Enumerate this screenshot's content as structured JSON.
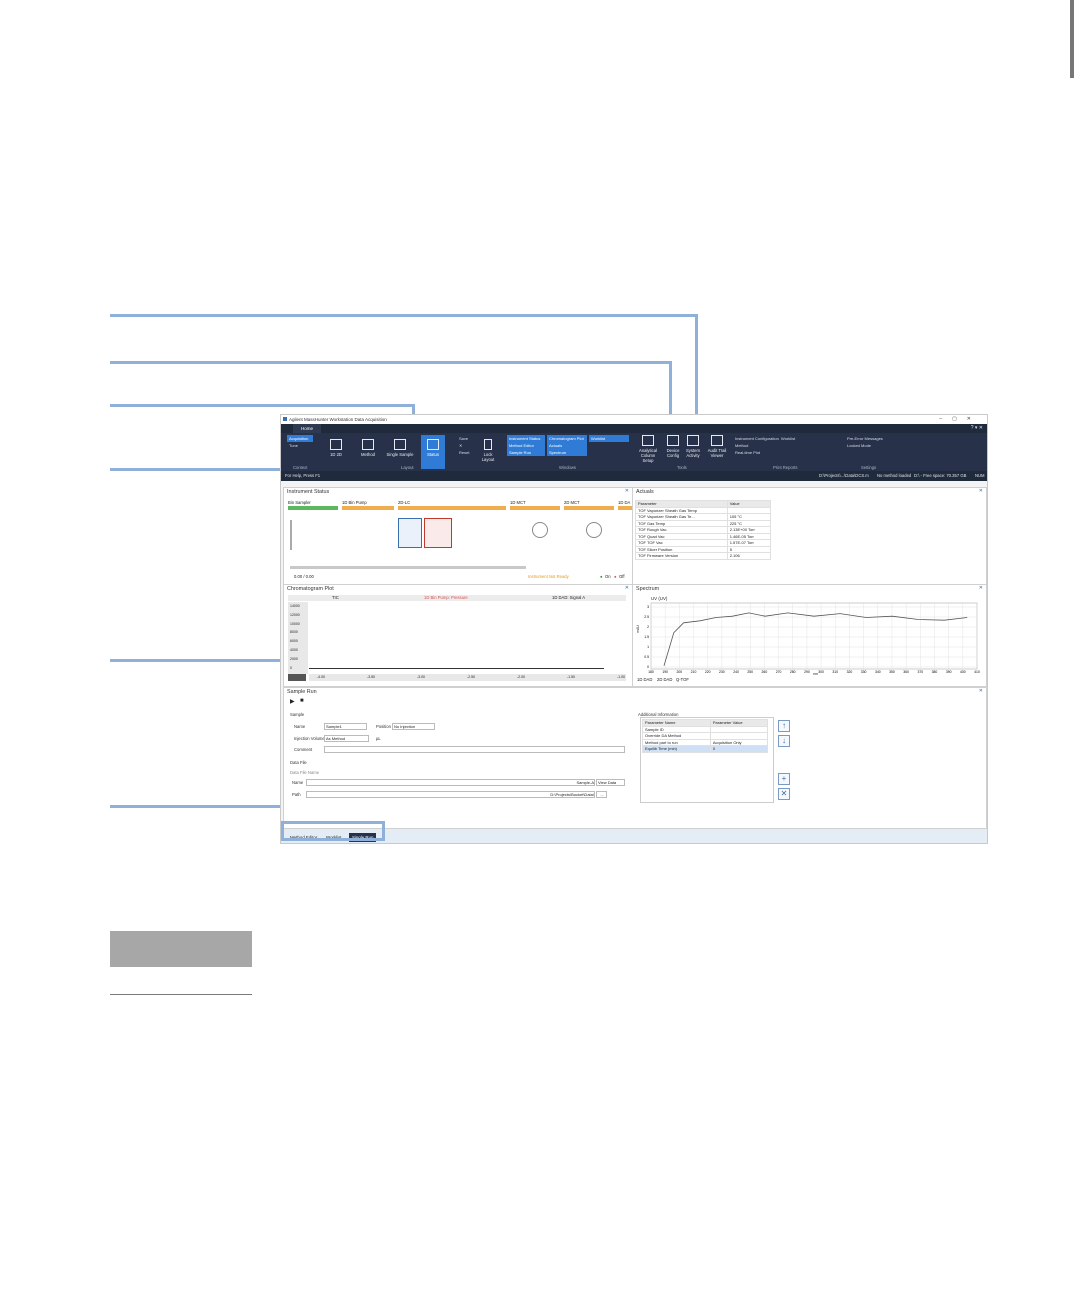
{
  "window": {
    "title": "Agilent MassHunter Workstation Data Acquisition",
    "tab_home": "Home"
  },
  "ribbon": {
    "context_items": [
      "Acquisition",
      "Tune"
    ],
    "context_group": "Context",
    "layout_buttons": [
      "1D 2D",
      "Method",
      "Single Sample",
      "Status"
    ],
    "layout_small": [
      "Save",
      "Reset",
      "Lock Layout"
    ],
    "layout_group": "Layout",
    "windows_col1": [
      "Instrument Status",
      "Method Editor",
      "Sample Run"
    ],
    "windows_col2": [
      "Chromatogram Plot",
      "Actuals",
      "Spectrum"
    ],
    "windows_col3": [
      "Worklist"
    ],
    "windows_group": "Windows",
    "tools_buttons": [
      "Analytical Column Setup",
      "Device Config",
      "System Activity",
      "Audit Trail Viewer"
    ],
    "tools_group": "Tools",
    "print_items": [
      "Instrument Configuration",
      "Method",
      "Real-time Plot"
    ],
    "print_extra": "Worklist",
    "print_group": "Print Reports",
    "settings_items": [
      "Pre-Error Messages",
      "Locked Mode"
    ],
    "settings_group": "Settings"
  },
  "status_bar": {
    "help": "For Help, Press F1",
    "segments": [
      "D:\\Projects\\...\\Data\\DCS.m",
      "No method loaded",
      "D:\\ - Free space: 70.357 GB",
      "NUM"
    ]
  },
  "instrument_status": {
    "title": "Instrument Status",
    "modules": [
      {
        "name": "Bin Sampler",
        "color": "#5cb85c"
      },
      {
        "name": "1D Bin Pump",
        "color": "#f0ad4e"
      },
      {
        "name": "2D-LC",
        "color": "#f0ad4e"
      },
      {
        "name": "1D MCT",
        "color": "#f0ad4e"
      },
      {
        "name": "2D MCT",
        "color": "#f0ad4e"
      },
      {
        "name": "1D DA",
        "color": "#f0ad4e"
      }
    ],
    "readout": "0.00 / 0.00",
    "legend": "Instrument Not Ready",
    "legend_on": "On",
    "legend_off": "Off"
  },
  "actuals": {
    "title": "Actuals",
    "headers": [
      "Parameter",
      "Value"
    ],
    "rows": [
      {
        "param": "TOF  Vaporizer Sheath Gas Temp",
        "value": ""
      },
      {
        "param": "TOF  Vaporizer Sheath Gas Te...",
        "value": "105 °C"
      },
      {
        "param": "TOF  Gas Temp",
        "value": "225 °C"
      },
      {
        "param": "TOF  Rough Vac",
        "value": "2.13E+00 Torr"
      },
      {
        "param": "TOF  Quad Vac",
        "value": "1.46E-05 Torr"
      },
      {
        "param": "TOF  TOF Vac",
        "value": "1.57E-07 Torr"
      },
      {
        "param": "TOF  Slicer Position",
        "value": "5"
      },
      {
        "param": "TOF  Firmware Version",
        "value": "2.106"
      }
    ]
  },
  "chromatogram": {
    "title": "Chromatogram Plot",
    "header_left": "TIC",
    "header_mid": "1D Bin Pump: Pressure",
    "header_right": "1D DAD: Signal A",
    "y_ticks": [
      "14000",
      "12000",
      "10000",
      "8000",
      "6000",
      "4000",
      "2000",
      "0"
    ],
    "x_ticks": [
      "-4.00",
      "-3.50",
      "-3.00",
      "-2.50",
      "-2.00",
      "-1.50",
      "-1.00"
    ]
  },
  "spectrum": {
    "title": "Spectrum",
    "series_label": "UV (UV)",
    "y_ticks": [
      "3",
      "2.5",
      "2",
      "1.5",
      "1",
      "0.5",
      "0"
    ],
    "x_ticks": [
      "180",
      "190",
      "200",
      "210",
      "220",
      "230",
      "240",
      "250",
      "260",
      "270",
      "280",
      "290",
      "300",
      "310",
      "320",
      "330",
      "340",
      "350",
      "360",
      "370",
      "380",
      "390",
      "400",
      "410"
    ],
    "xlabel": "nm",
    "ylabel": "mAU",
    "tabs": [
      "1D DAD",
      "2D DAD",
      "Q-TOF"
    ]
  },
  "sample_run": {
    "title": "Sample Run",
    "sample_label": "Sample",
    "name_label": "Name",
    "name_value": "Sample1",
    "position_label": "Position",
    "position_value": "No Injection",
    "injection_label": "Injection Volume",
    "injection_value": "As Method",
    "injection_unit": "µL",
    "comment_label": "Comment",
    "datafile_label": "Data File",
    "datafile_sub": "Data File Name",
    "df_name_label": "Name",
    "df_name_value": "Sample-A",
    "df_path_label": "Path",
    "df_path_value": "D:\\Projects\\Bucket\\Data\\",
    "view_data": "View Data",
    "browse": "...",
    "addl_title": "Additional Information",
    "addl_headers": [
      "Parameter Name",
      "Parameter Value"
    ],
    "addl_rows": [
      {
        "name": "Sample ID",
        "value": ""
      },
      {
        "name": "Override DA Method",
        "value": ""
      },
      {
        "name": "Method part to run",
        "value": "Acquisition Only"
      },
      {
        "name": "Equilib Time (min)",
        "value": "0"
      }
    ]
  },
  "bottom_tabs": [
    "Method Editor",
    "Worklist",
    "Single Run"
  ]
}
